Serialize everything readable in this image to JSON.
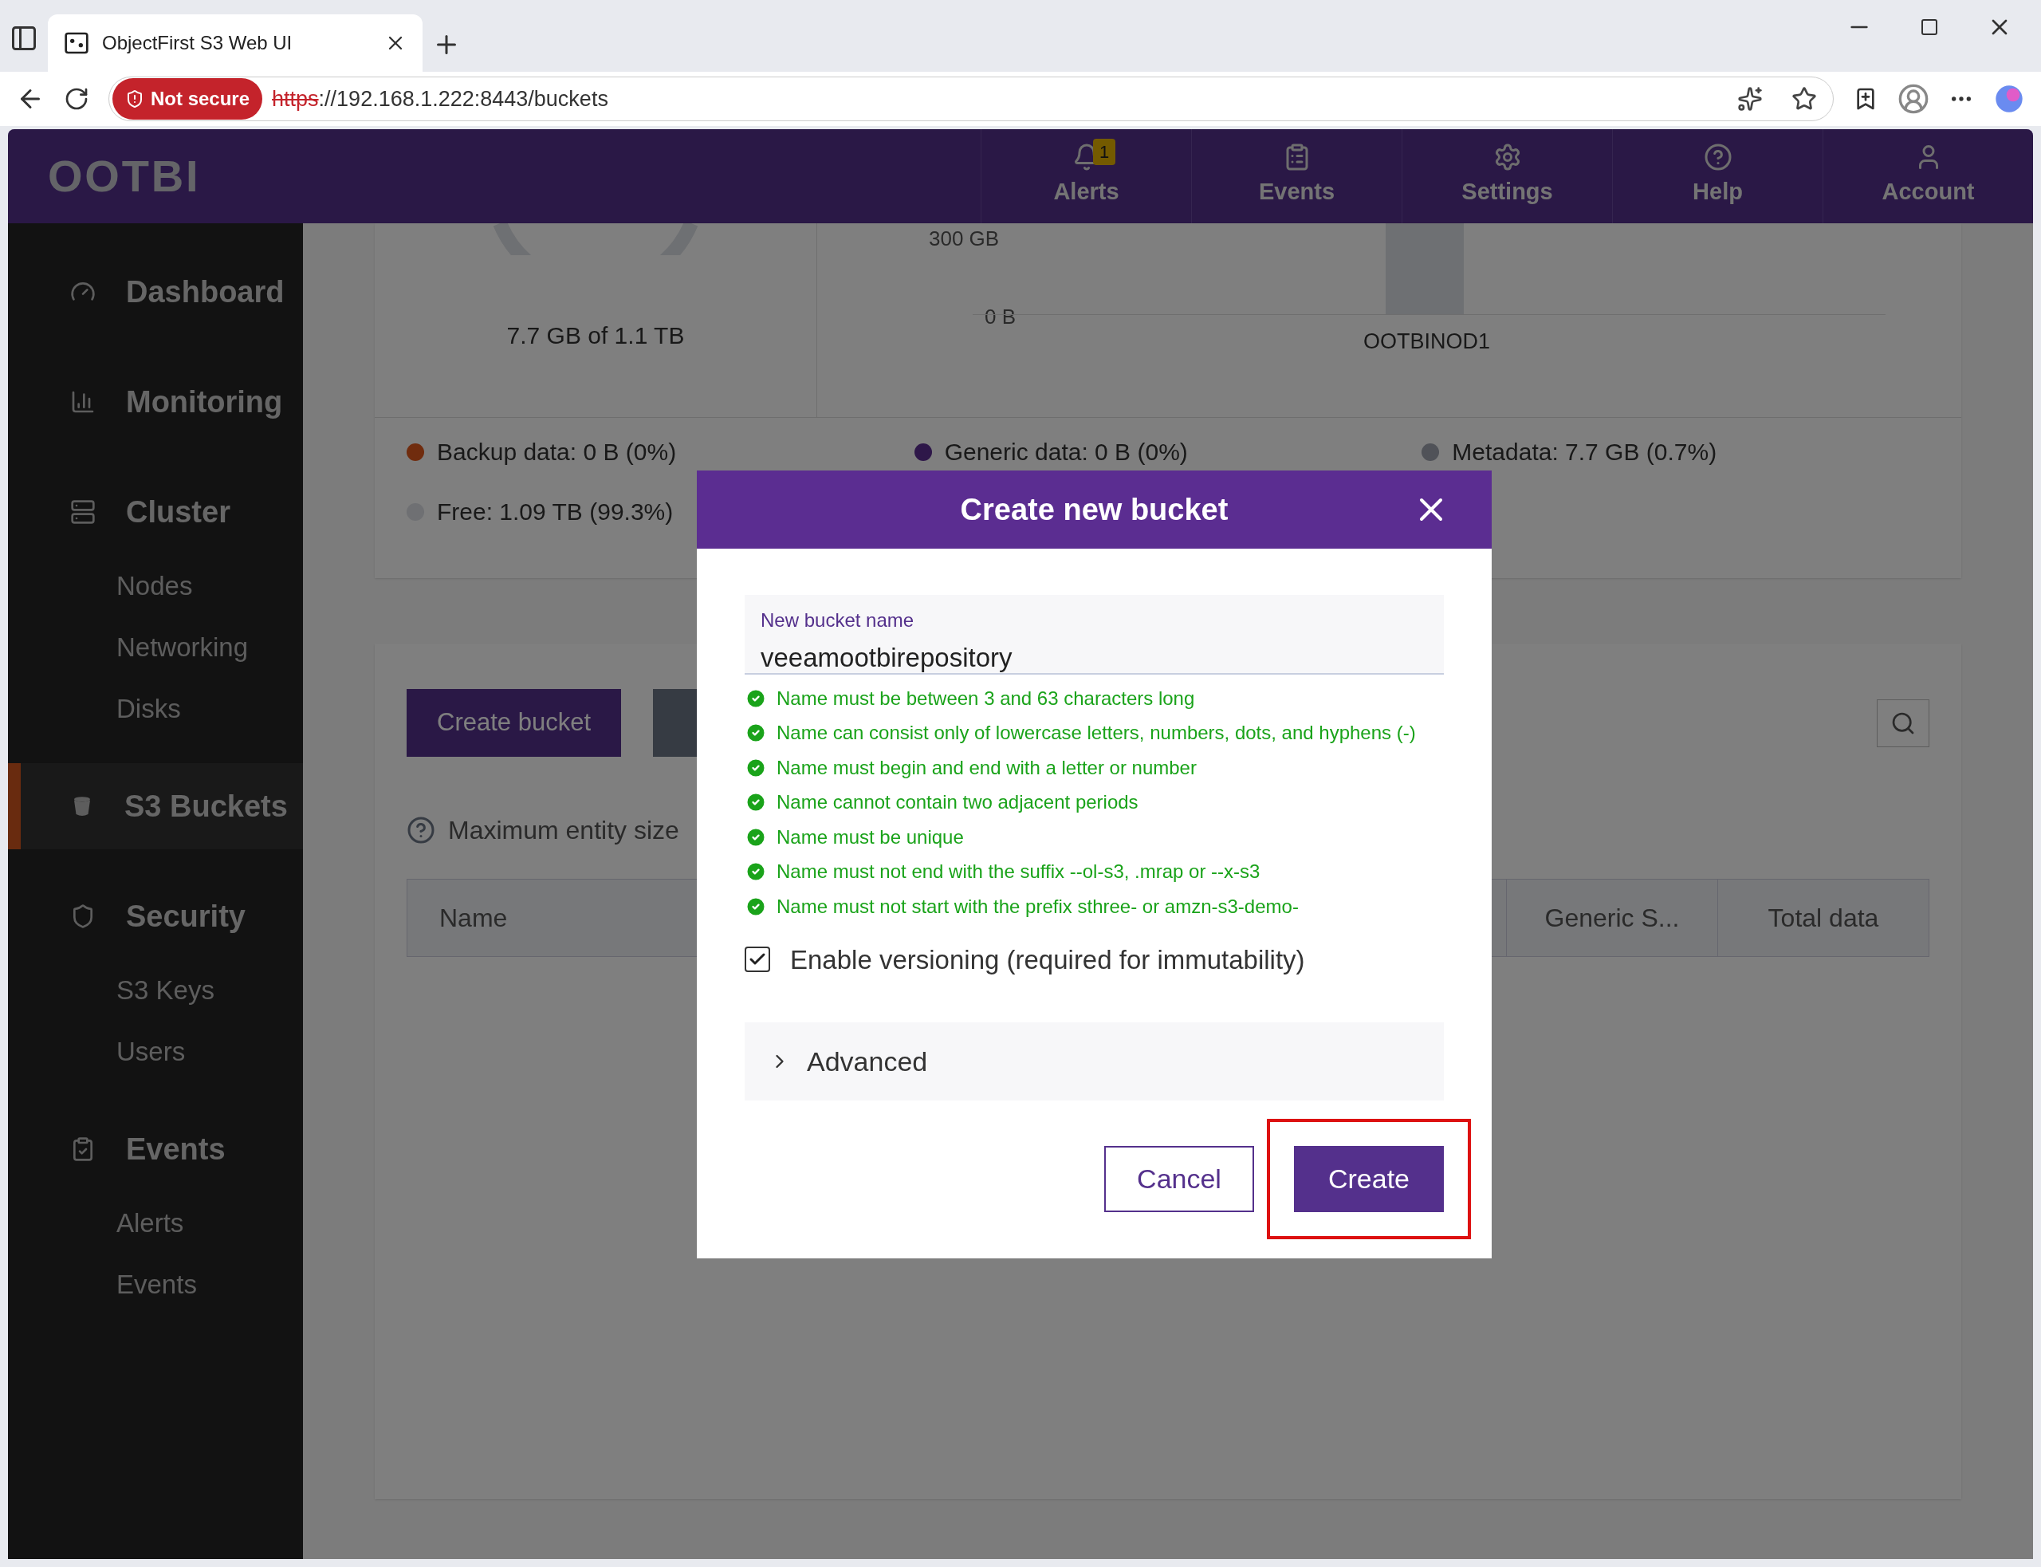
{
  "browser": {
    "tab_title": "ObjectFirst S3 Web UI",
    "security_badge": "Not secure",
    "url_scheme": "https",
    "url_rest": "://192.168.1.222:8443/buckets"
  },
  "header": {
    "logo": "OOTBI",
    "nav": [
      {
        "label": "Alerts",
        "badge": "1"
      },
      {
        "label": "Events"
      },
      {
        "label": "Settings"
      },
      {
        "label": "Help"
      },
      {
        "label": "Account"
      }
    ]
  },
  "sidebar": [
    {
      "label": "Dashboard",
      "selected": false
    },
    {
      "label": "Monitoring",
      "selected": false
    },
    {
      "label": "Cluster",
      "selected": false,
      "children": [
        {
          "label": "Nodes",
          "selected": false
        },
        {
          "label": "Networking",
          "selected": false
        },
        {
          "label": "Disks",
          "selected": false
        }
      ]
    },
    {
      "label": "S3 Buckets",
      "selected": true
    },
    {
      "label": "Security",
      "selected": false,
      "children": [
        {
          "label": "S3 Keys",
          "selected": false
        },
        {
          "label": "Users",
          "selected": false
        }
      ]
    },
    {
      "label": "Events",
      "selected": false,
      "children": [
        {
          "label": "Alerts",
          "selected": false
        },
        {
          "label": "Events",
          "selected": false
        }
      ]
    }
  ],
  "storage": {
    "capacity": "7.7 GB of 1.1 TB",
    "y_axis_top": "300 GB",
    "y_axis_bottom": "0 B",
    "node": "OOTBINOD1",
    "legend": [
      {
        "label": "Backup data: 0 B (0%)",
        "color": "#702c0e"
      },
      {
        "label": "Generic data: 0 B (0%)",
        "color": "#2e1749"
      },
      {
        "label": "Metadata: 7.7 GB (0.7%)",
        "color": "#505258"
      },
      {
        "label": "Free: 1.09 TB (99.3%)",
        "color": "#6f7073"
      }
    ]
  },
  "buckets": {
    "create_button": "Create bucket",
    "info": "Maximum entity size",
    "columns": [
      "Name",
      "Generic S...",
      "Total data"
    ]
  },
  "dialog": {
    "title": "Create new bucket",
    "field_label": "New bucket name",
    "field_value": "veeamootbirepository",
    "rules": [
      {
        "text": "Name must be between 3 and 63 characters long",
        "passed": true
      },
      {
        "text": "Name can consist only of lowercase letters, numbers, dots, and hyphens (-)",
        "passed": true
      },
      {
        "text": "Name must begin and end with a letter or number",
        "passed": true
      },
      {
        "text": "Name cannot contain two adjacent periods",
        "passed": true
      },
      {
        "text": "Name must be unique",
        "passed": true
      },
      {
        "text": "Name must not end with the suffix --ol-s3, .mrap or --x-s3",
        "passed": true
      },
      {
        "text": "Name must not start with the prefix sthree- or amzn-s3-demo-",
        "passed": true
      }
    ],
    "versioning": {
      "label": "Enable versioning (required for immutability)",
      "checked": true
    },
    "advanced": {
      "label": "Advanced",
      "expanded": false
    },
    "cancel": "Cancel",
    "create": "Create"
  }
}
